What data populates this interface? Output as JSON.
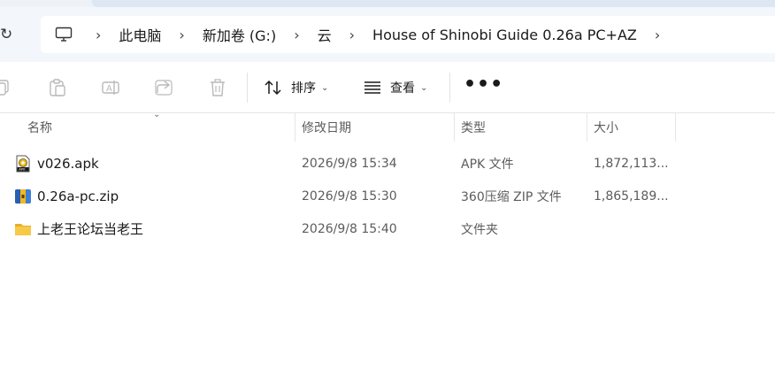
{
  "address_bar": {
    "breadcrumbs": [
      "此电脑",
      "新加卷 (G:)",
      "云",
      "House of Shinobi Guide 0.26a PC+AZ"
    ]
  },
  "toolbar": {
    "sort_label": "排序",
    "view_label": "查看",
    "more_label": "•••"
  },
  "columns": {
    "name": "名称",
    "date": "修改日期",
    "type": "类型",
    "size": "大小"
  },
  "files": [
    {
      "name": "v026.apk",
      "date": "2026/9/8 15:34",
      "type": "APK 文件",
      "size": "1,872,113...",
      "icon": "apk-file-icon"
    },
    {
      "name": "0.26a-pc.zip",
      "date": "2026/9/8 15:30",
      "type": "360压缩 ZIP 文件",
      "size": "1,865,189...",
      "icon": "zip-archive-icon"
    },
    {
      "name": "上老王论坛当老王",
      "date": "2026/9/8 15:40",
      "type": "文件夹",
      "size": "",
      "icon": "folder-icon"
    }
  ],
  "colors": {
    "address_row_bg": "#f3f6fb",
    "folder_yellow": "#f5c542",
    "disabled_icon": "#b9b9b9"
  }
}
